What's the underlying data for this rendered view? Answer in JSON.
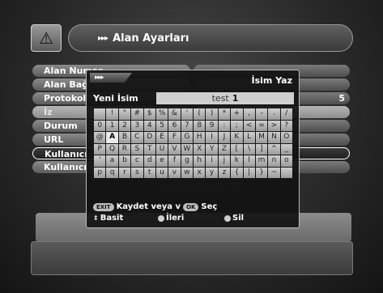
{
  "header": {
    "logo_glyph": "⚠",
    "arrows": "▸▸▸",
    "title": "Alan Ayarları"
  },
  "settings_rows": [
    {
      "label": "Alan Numar",
      "value": "",
      "state": "normal"
    },
    {
      "label": "Alan Bağ",
      "value": "",
      "state": "normal"
    },
    {
      "label": "Protokol",
      "value": "5",
      "state": "normal"
    },
    {
      "label": "İz",
      "value": "",
      "state": "dim"
    },
    {
      "label": "Durum",
      "value": "",
      "state": "normal"
    },
    {
      "label": "URL",
      "value": "",
      "state": "normal"
    },
    {
      "label": "Kullanıcı",
      "value": "",
      "state": "selected"
    },
    {
      "label": "Kullanıcı",
      "value": "",
      "state": "normal"
    }
  ],
  "dialog": {
    "tab_arrows": "▸▸▸",
    "title": "İsim Yaz",
    "name_label": "Yeni İsim",
    "name_value": "test",
    "cursor": "1",
    "keyboard": [
      [
        "",
        "!",
        "\"",
        "#",
        "$",
        "%",
        "&",
        "'",
        "(",
        ")",
        "*",
        "+",
        ",",
        "-",
        ".",
        "/"
      ],
      [
        "0",
        "1",
        "2",
        "3",
        "4",
        "5",
        "6",
        "7",
        "8",
        "9",
        ":",
        ";",
        "<",
        "=",
        ">",
        "?"
      ],
      [
        "@",
        "A",
        "B",
        "C",
        "D",
        "E",
        "F",
        "G",
        "H",
        "I",
        "J",
        "K",
        "L",
        "M",
        "N",
        "O"
      ],
      [
        "P",
        "Q",
        "R",
        "S",
        "T",
        "U",
        "V",
        "W",
        "X",
        "Y",
        "Z",
        "[",
        "\\",
        "]",
        "^",
        "_"
      ],
      [
        "'",
        "a",
        "b",
        "c",
        "d",
        "e",
        "f",
        "g",
        "h",
        "i",
        "j",
        "k",
        "l",
        "m",
        "n",
        "o"
      ],
      [
        "p",
        "q",
        "r",
        "s",
        "t",
        "u",
        "v",
        "w",
        "x",
        "y",
        "z",
        "{",
        "|",
        "}",
        "~",
        ""
      ]
    ],
    "highlight_key": "A",
    "help": {
      "exit_pill": "EXIT",
      "save_text": "Kaydet veya v",
      "ok_pill": "OK",
      "select_text": "Seç",
      "basic": "Basit",
      "next": "İleri",
      "delete": "Sil"
    }
  },
  "colors": {
    "background": "#2a2a2a",
    "key_face": "#cfcfcf",
    "accent_border": "#ffffff"
  }
}
